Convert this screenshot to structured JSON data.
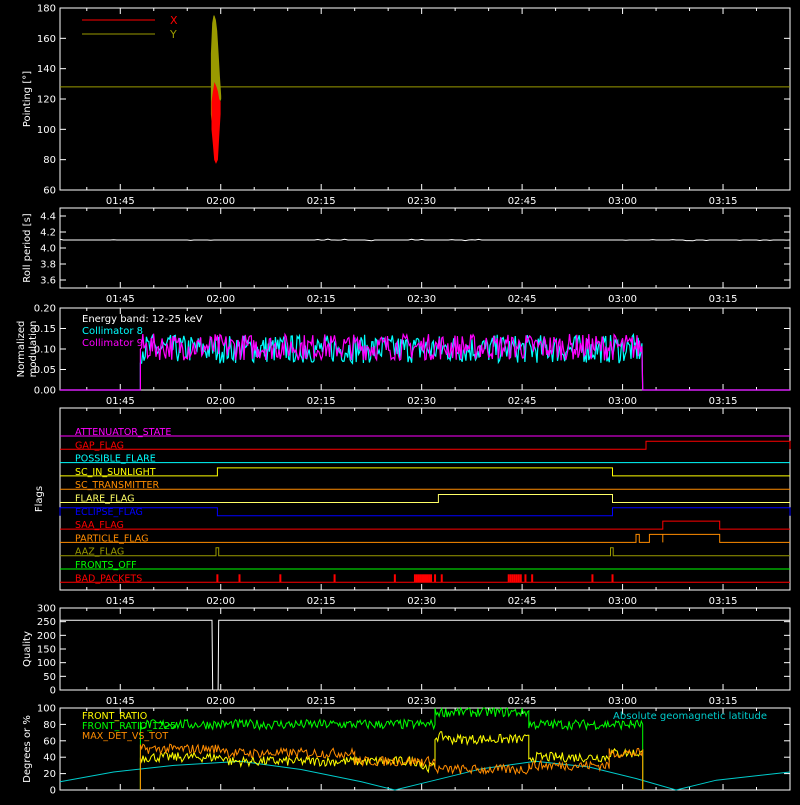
{
  "chart_data": [
    {
      "id": "pointing",
      "type": "line",
      "ylabel": "Pointing [°]",
      "xticks": [
        "01:45",
        "02:00",
        "02:15",
        "02:30",
        "02:45",
        "03:00",
        "03:15"
      ],
      "xlim_min": [
        96,
        205
      ],
      "yticks": [
        60,
        80,
        100,
        120,
        140,
        160,
        180
      ],
      "ylim": [
        60,
        180
      ],
      "reference_line": 128,
      "legend": [
        "X",
        "Y"
      ],
      "colors": {
        "X": "#ff0000",
        "Y": "#9a9a00",
        "reference": "#9a9a00"
      },
      "series": [
        {
          "name": "X",
          "min": [
            [
              118.7,
              100
            ],
            [
              118.9,
              90
            ],
            [
              119.1,
              80
            ],
            [
              119.3,
              78
            ],
            [
              119.5,
              80
            ],
            [
              119.7,
              95
            ],
            [
              119.9,
              110
            ]
          ],
          "max": [
            [
              118.7,
              118
            ],
            [
              118.9,
              125
            ],
            [
              119.1,
              130
            ],
            [
              119.3,
              128
            ],
            [
              119.5,
              125
            ],
            [
              119.7,
              120
            ],
            [
              119.9,
              118
            ]
          ]
        },
        {
          "name": "Y",
          "min": [
            [
              118.6,
              110
            ],
            [
              118.8,
              100
            ],
            [
              119.0,
              95
            ],
            [
              119.2,
              100
            ],
            [
              119.4,
              110
            ],
            [
              119.6,
              115
            ],
            [
              119.8,
              118
            ],
            [
              120.0,
              120
            ]
          ],
          "max": [
            [
              118.6,
              150
            ],
            [
              118.8,
              170
            ],
            [
              119.0,
              175
            ],
            [
              119.2,
              172
            ],
            [
              119.4,
              165
            ],
            [
              119.6,
              150
            ],
            [
              119.8,
              135
            ],
            [
              120.0,
              122
            ]
          ]
        }
      ]
    },
    {
      "id": "roll",
      "type": "line",
      "ylabel": "Roll period [s]",
      "xticks": [
        "01:45",
        "02:00",
        "02:15",
        "02:30",
        "02:45",
        "03:00",
        "03:15"
      ],
      "yticks": [
        "3.6",
        "3.8",
        "4.0",
        "4.2",
        "4.4"
      ],
      "ylim": [
        3.5,
        4.5
      ],
      "series": [
        {
          "name": "",
          "value": 4.1,
          "color": "#ffffff"
        }
      ]
    },
    {
      "id": "modulation",
      "type": "line",
      "ylabel": "Normalized modulation",
      "ylabel_lines": [
        "Normalized",
        "modulation"
      ],
      "xticks": [
        "01:45",
        "02:00",
        "02:15",
        "02:30",
        "02:45",
        "03:00",
        "03:15"
      ],
      "yticks": [
        "0.00",
        "0.05",
        "0.10",
        "0.15",
        "0.20"
      ],
      "ylim": [
        0,
        0.2
      ],
      "annotation": "Energy band: 12-25 keV",
      "series": [
        {
          "name": "Collimator 8",
          "color": "#00ffff",
          "start_min": 108,
          "end_min": 183,
          "mean": 0.1,
          "range": [
            0.07,
            0.14
          ]
        },
        {
          "name": "Collimator 9",
          "color": "#ff00ff",
          "start_min": 108,
          "end_min": 183,
          "mean": 0.105,
          "range": [
            0.085,
            0.15
          ]
        }
      ]
    },
    {
      "id": "flags",
      "type": "line",
      "ylabel": "Flags",
      "xticks": [
        "01:45",
        "02:00",
        "02:15",
        "02:30",
        "02:45",
        "03:00",
        "03:15"
      ],
      "rows": [
        {
          "name": "ATTENUATOR_STATE",
          "color": "#ff00ff",
          "segments": []
        },
        {
          "name": "GAP_FLAG",
          "color": "#ff0000",
          "segments": [
            [
              183.5,
              205
            ]
          ]
        },
        {
          "name": "POSSIBLE_FLARE",
          "color": "#00ffff",
          "segments": []
        },
        {
          "name": "SC_IN_SUNLIGHT",
          "color": "#ffff00",
          "segments": [
            [
              119.5,
              178.5
            ]
          ]
        },
        {
          "name": "SC_TRANSMITTER",
          "color": "#ff8c00",
          "segments": []
        },
        {
          "name": "FLARE_FLAG",
          "color": "#ffff66",
          "segments": [
            [
              152.5,
              178.5
            ]
          ]
        },
        {
          "name": "ECLIPSE_FLAG",
          "color": "#0000ff",
          "segments": [
            [
              96,
              119.5
            ],
            [
              178.5,
              205
            ]
          ]
        },
        {
          "name": "SAA_FLAG",
          "color": "#ff0000",
          "segments": [
            [
              186,
              194.5
            ]
          ]
        },
        {
          "name": "PARTICLE_FLAG",
          "color": "#ff8c00",
          "segments": [
            [
              182,
              182.5
            ],
            [
              184,
              186
            ],
            [
              186,
              194.5
            ]
          ]
        },
        {
          "name": "AAZ_FLAG",
          "color": "#9a9a00",
          "segments": [
            [
              119.3,
              119.7
            ],
            [
              178.2,
              178.6
            ]
          ]
        },
        {
          "name": "FRONTS_OFF",
          "color": "#00ff00",
          "segments": []
        },
        {
          "name": "BAD_PACKETS",
          "color": "#ff0000",
          "spikes": [
            119.5,
            122.8,
            128.9,
            137.0,
            146.0,
            149.0,
            149.3,
            149.6,
            149.9,
            150.2,
            150.5,
            150.8,
            151.1,
            151.4,
            152.0,
            153.0,
            163.0,
            163.3,
            163.6,
            163.9,
            164.2,
            164.5,
            164.8,
            165.5,
            166.5,
            175.5,
            178.5
          ]
        }
      ]
    },
    {
      "id": "quality",
      "type": "line",
      "ylabel": "Quality",
      "xticks": [
        "01:45",
        "02:00",
        "02:15",
        "02:30",
        "02:45",
        "03:00",
        "03:15"
      ],
      "yticks": [
        0,
        50,
        100,
        150,
        200,
        250,
        300
      ],
      "ylim": [
        0,
        300
      ],
      "series": [
        {
          "name": "",
          "color": "#ffffff",
          "points": [
            [
              96,
              255
            ],
            [
              118.7,
              255
            ],
            [
              118.8,
              0
            ],
            [
              119.6,
              0
            ],
            [
              119.7,
              255
            ],
            [
              205,
              255
            ]
          ]
        }
      ]
    },
    {
      "id": "ratios",
      "type": "line",
      "ylabel": "Degrees or %",
      "yticks": [
        0,
        20,
        40,
        60,
        80,
        100
      ],
      "ylim": [
        0,
        100
      ],
      "legend": [
        "FRONT_RATIO",
        "FRONT_RATIO_1225",
        "MAX_DET_VS_TOT"
      ],
      "right_legend": "Absolute geomagnetic latitude",
      "series": [
        {
          "name": "FRONT_RATIO",
          "color": "#ffff00",
          "levels": [
            [
              108,
              121,
              40
            ],
            [
              121,
              150,
              35
            ],
            [
              150,
              152,
              28
            ],
            [
              152,
              154,
              65
            ],
            [
              154,
              166,
              62
            ],
            [
              166,
              178,
              40
            ],
            [
              178,
              183,
              45
            ]
          ]
        },
        {
          "name": "FRONT_RATIO_1225",
          "color": "#00ff00",
          "levels": [
            [
              108,
              152,
              80
            ],
            [
              152,
              154,
              95
            ],
            [
              154,
              166,
              95
            ],
            [
              166,
              183,
              80
            ]
          ]
        },
        {
          "name": "MAX_DET_VS_TOT",
          "color": "#ff8c00",
          "levels": [
            [
              108,
              121,
              50
            ],
            [
              121,
              140,
              45
            ],
            [
              140,
              152,
              35
            ],
            [
              152,
              166,
              25
            ],
            [
              166,
              178,
              30
            ],
            [
              178,
              183,
              45
            ]
          ]
        },
        {
          "name": "Absolute geomagnetic latitude",
          "color": "#00cccc",
          "points": [
            [
              96,
              10
            ],
            [
              104,
              22
            ],
            [
              113,
              30
            ],
            [
              123,
              35
            ],
            [
              132,
              25
            ],
            [
              141,
              10
            ],
            [
              146,
              0
            ],
            [
              151,
              10
            ],
            [
              159,
              26
            ],
            [
              167,
              35
            ],
            [
              175,
              28
            ],
            [
              182,
              14
            ],
            [
              188,
              0
            ],
            [
              194,
              12
            ],
            [
              205,
              22
            ]
          ]
        }
      ]
    }
  ]
}
